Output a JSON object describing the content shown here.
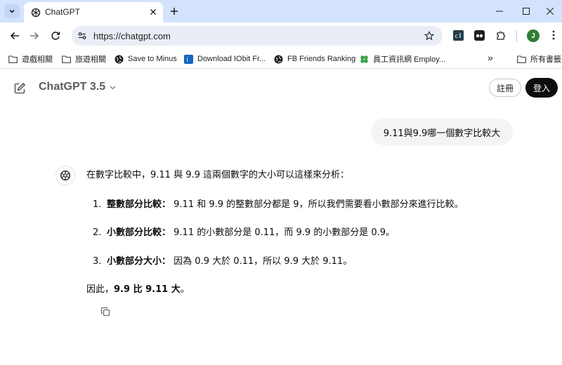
{
  "browser": {
    "tab_title": "ChatGPT",
    "url": "https://chatgpt.com",
    "profile_initial": "J",
    "bookmarks": [
      {
        "label": "遊戲相關",
        "icon": "folder-icon"
      },
      {
        "label": "旅遊相關",
        "icon": "folder-icon"
      },
      {
        "label": "Save to Minus",
        "icon": "globe-icon"
      },
      {
        "label": "Download IObit Fr...",
        "icon": "iobit-icon"
      },
      {
        "label": "FB Friends Ranking",
        "icon": "globe-icon"
      },
      {
        "label": "員工資訊網 Employ...",
        "icon": "clover-icon"
      },
      {
        "label": "所有書籤",
        "icon": "folder-icon"
      }
    ],
    "bookmarks_overflow": "»"
  },
  "app": {
    "model_name": "ChatGPT 3.5",
    "signup_label": "註冊",
    "login_label": "登入"
  },
  "conversation": {
    "user_message": "9.11與9.9哪一個數字比較大",
    "answer": {
      "intro": "在數字比較中，9.11 與 9.9 這兩個數字的大小可以這樣來分析：",
      "items": [
        {
          "num": "1.",
          "title": "整數部分比較：",
          "text": "9.11 和 9.9 的整數部分都是 9，所以我們需要看小數部分來進行比較。"
        },
        {
          "num": "2.",
          "title": "小數部分比較：",
          "text": "9.11 的小數部分是 0.11，而 9.9 的小數部分是 0.9。"
        },
        {
          "num": "3.",
          "title": "小數部分大小：",
          "text": "因為 0.9 大於 0.11，所以 9.9 大於 9.11。"
        }
      ],
      "conclusion_prefix": "因此，",
      "conclusion_bold": "9.9 比 9.11 大",
      "conclusion_suffix": "。"
    }
  },
  "colors": {
    "tabstrip": "#d3e3fd",
    "omnibox": "#e9eef6",
    "user_bubble": "#f4f4f4",
    "login_button": "#0d0d0d",
    "profile": "#2e7d32"
  }
}
